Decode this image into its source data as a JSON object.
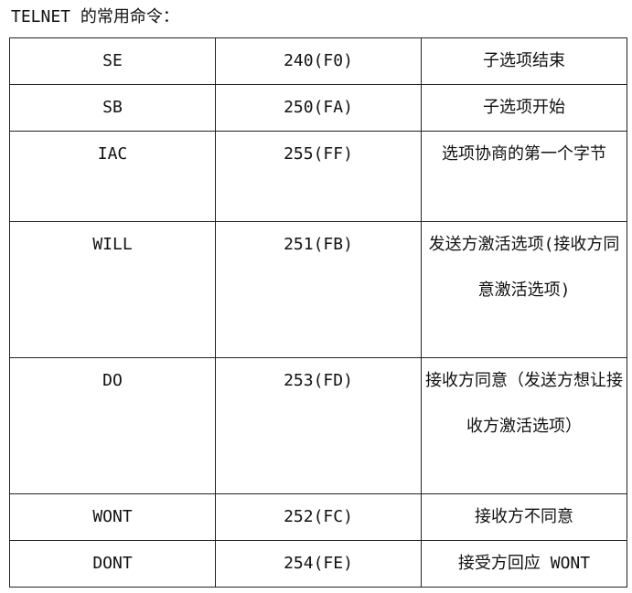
{
  "heading": "TELNET 的常用命令：",
  "rows": [
    {
      "name": "SE",
      "code": "240(F0)",
      "desc": "子选项结束"
    },
    {
      "name": "SB",
      "code": "250(FA)",
      "desc": "子选项开始"
    },
    {
      "name": "IAC",
      "code": "255(FF)",
      "desc": "选项协商的第一个字节"
    },
    {
      "name": "WILL",
      "code": "251(FB)",
      "desc": "发送方激活选项(接收方同意激活选项)"
    },
    {
      "name": "DO",
      "code": "253(FD)",
      "desc": "接收方同意（发送方想让接收方激活选项）"
    },
    {
      "name": "WONT",
      "code": "252(FC)",
      "desc": "接收方不同意"
    },
    {
      "name": "DONT",
      "code": "254(FE)",
      "desc": "接受方回应 WONT"
    }
  ]
}
